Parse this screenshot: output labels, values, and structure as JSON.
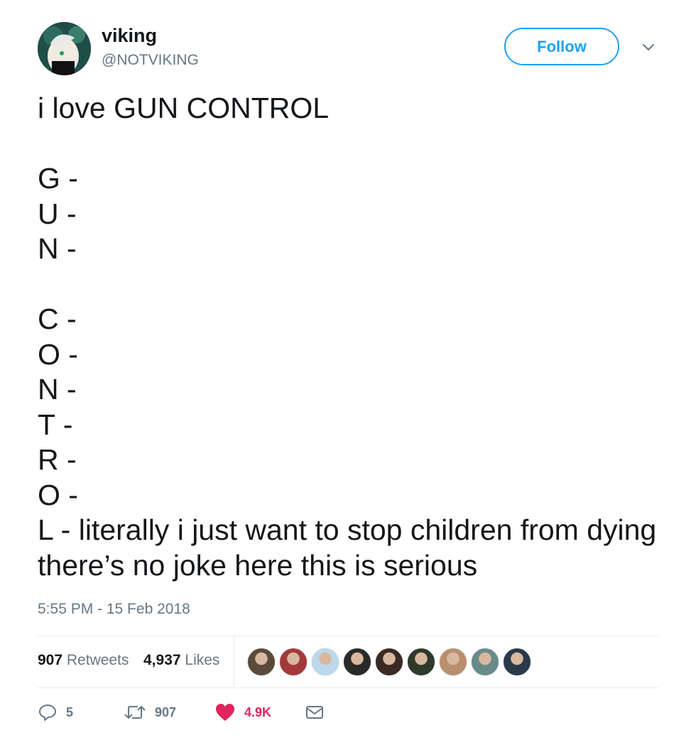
{
  "user": {
    "display_name": "viking",
    "handle": "@NOTVIKING",
    "avatar_icon": "avatar-image"
  },
  "follow_label": "Follow",
  "tweet": {
    "text": "i love GUN CONTROL\n\nG -\nU -\nN -\n\nC -\nO -\nN -\nT -\nR -\nO -\nL - literally i just want to stop children from dying there’s no joke here this is serious",
    "timestamp": "5:55 PM - 15 Feb 2018"
  },
  "stats": {
    "retweets_count": "907",
    "retweets_label": "Retweets",
    "likes_count": "4,937",
    "likes_label": "Likes",
    "liker_colors": [
      "#5a4a3a",
      "#a23a3a",
      "#bcd8ea",
      "#2a2a2a",
      "#3a2a22",
      "#2f3a2a",
      "#b89070",
      "#6a8a8a",
      "#2a3a4a"
    ]
  },
  "actions": {
    "reply_count": "5",
    "retweet_count": "907",
    "like_count": "4.9K",
    "like_color": "#e0245e",
    "muted_color": "#657786"
  }
}
